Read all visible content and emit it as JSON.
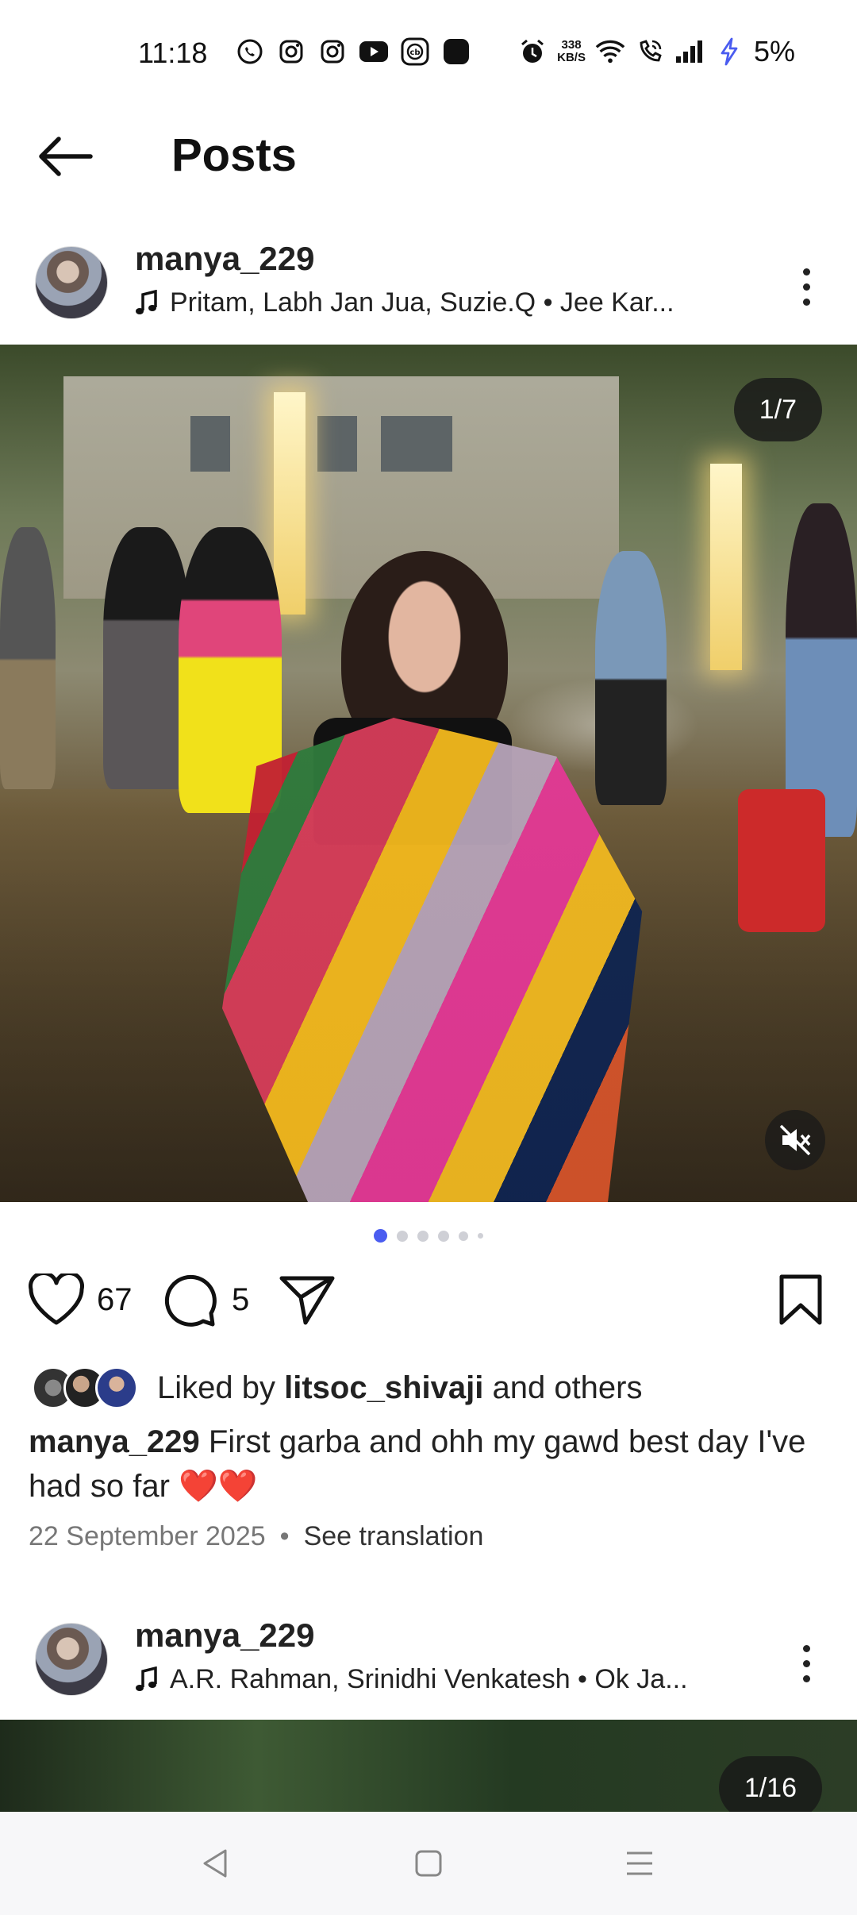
{
  "status_bar": {
    "time": "11:18",
    "net_speed_value": "338",
    "net_speed_unit": "KB/S",
    "battery": "5%",
    "left_icons": [
      "whatsapp-icon",
      "instagram-icon",
      "instagram-icon",
      "youtube-icon",
      "cricbuzz-icon",
      "app-icon"
    ],
    "right_icons": [
      "alarm-icon",
      "wifi-icon",
      "wifi-call-icon",
      "signal-icon",
      "charging-icon"
    ]
  },
  "header": {
    "title": "Posts"
  },
  "posts": [
    {
      "username": "manya_229",
      "music": "Pritam, Labh Jan Jua, Suzie.Q • Jee Kar...",
      "media_counter": "1/7",
      "likes": "67",
      "comments": "5",
      "liked_by_prefix": "Liked by",
      "liked_by_user": "litsoc_shivaji",
      "liked_by_suffix": "and others",
      "caption_user": "manya_229",
      "caption_text": "First garba and ohh my gawd best day I've had so far ❤️❤️",
      "date": "22 September 2025",
      "separator": "•",
      "translate": "See translation"
    },
    {
      "username": "manya_229",
      "music": "A.R. Rahman, Srinidhi Venkatesh • Ok Ja...",
      "media_counter": "1/16"
    }
  ],
  "colors": {
    "accent": "#4a5cf0",
    "text": "#111111",
    "muted": "#777777"
  }
}
